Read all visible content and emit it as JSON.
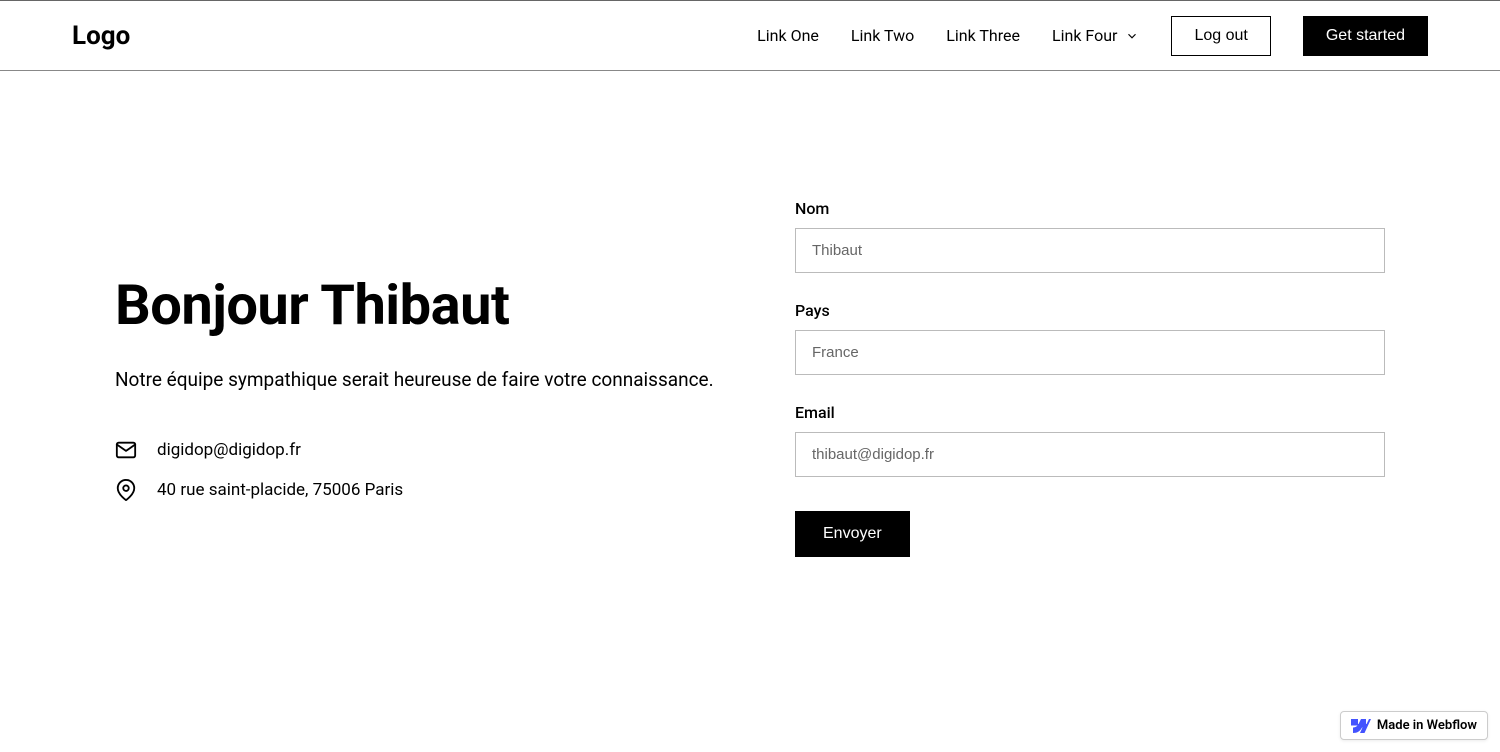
{
  "header": {
    "logo": "Logo",
    "links": [
      "Link One",
      "Link Two",
      "Link Three",
      "Link Four"
    ],
    "logout": "Log out",
    "get_started": "Get started"
  },
  "hero": {
    "heading": "Bonjour Thibaut",
    "subtext": "Notre équipe sympathique serait heureuse de faire votre connaissance.",
    "email": "digidop@digidop.fr",
    "address": "40 rue saint-placide, 75006 Paris"
  },
  "form": {
    "name_label": "Nom",
    "name_value": "Thibaut",
    "country_label": "Pays",
    "country_value": "France",
    "email_label": "Email",
    "email_value": "thibaut@digidop.fr",
    "submit": "Envoyer"
  },
  "badge": "Made in Webflow"
}
